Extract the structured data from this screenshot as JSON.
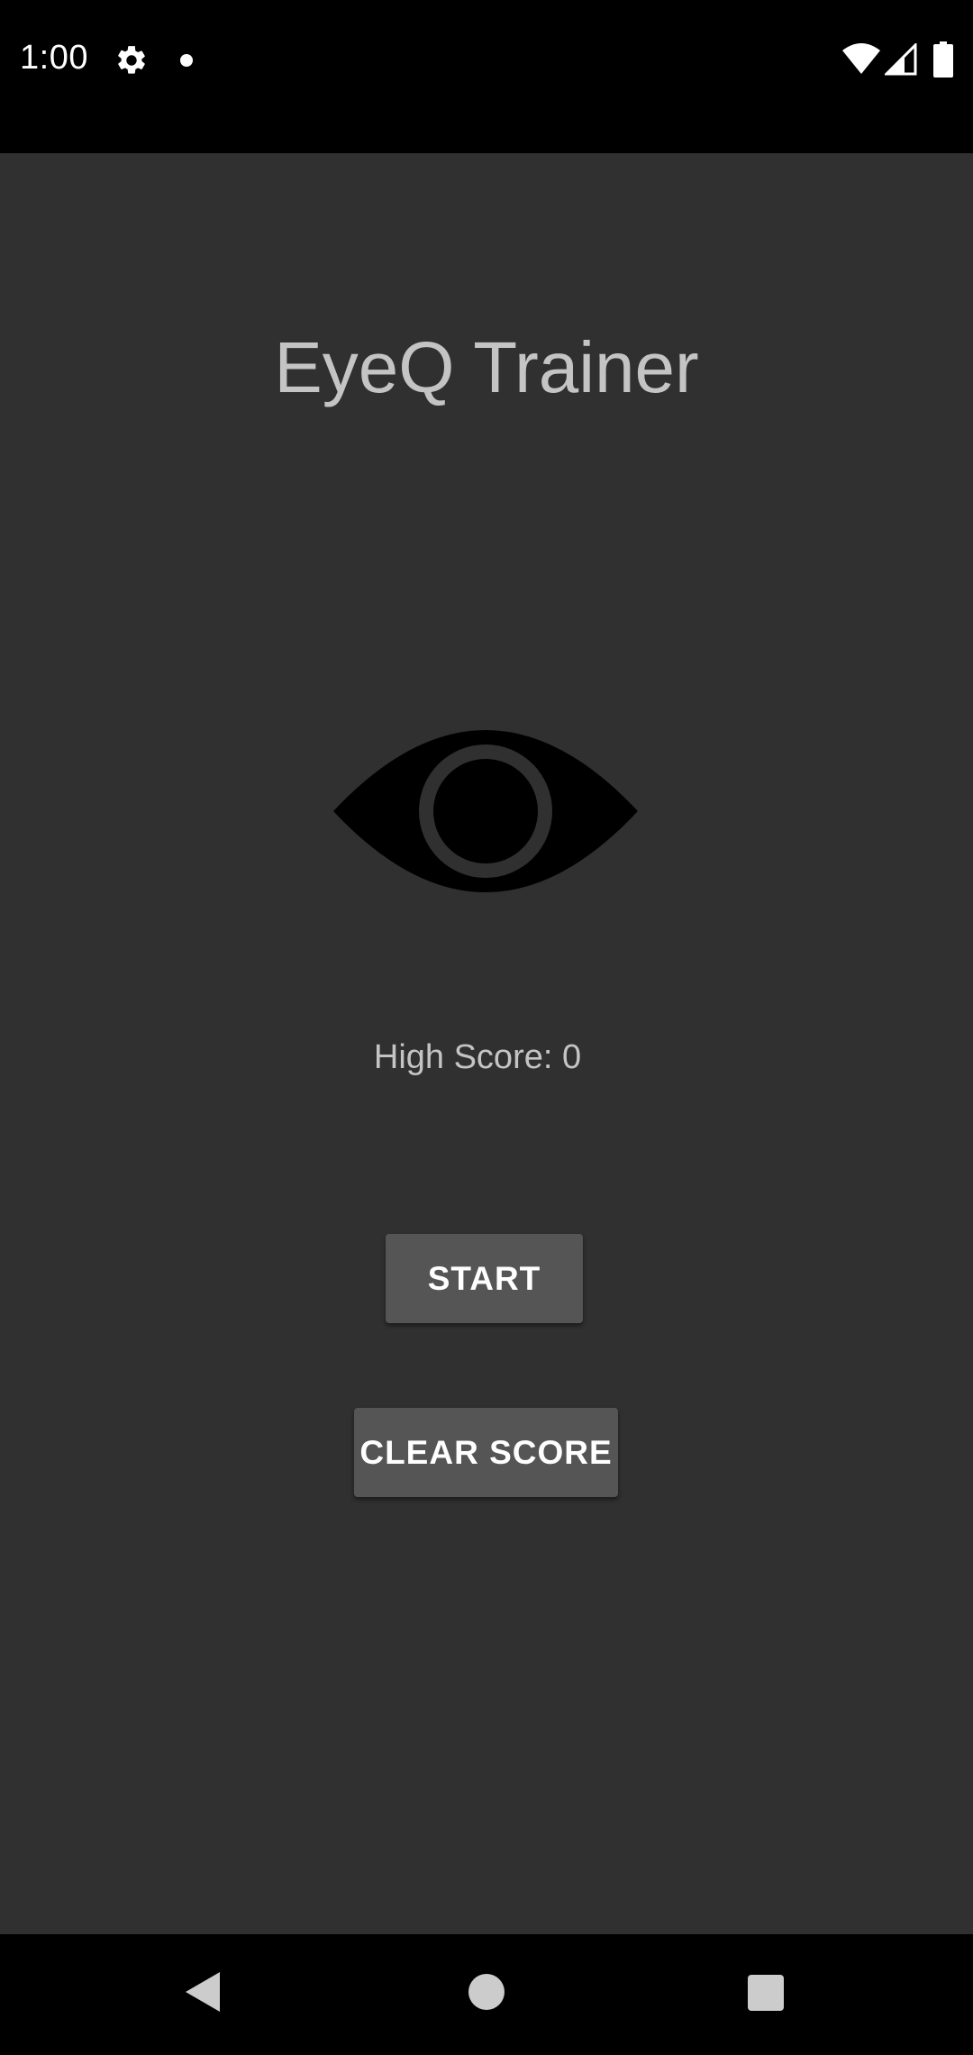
{
  "status_bar": {
    "time": "1:00",
    "icons": [
      "gear-icon",
      "notification-dot-icon",
      "wifi-icon",
      "cell-signal-icon",
      "battery-icon"
    ]
  },
  "app": {
    "title": "EyeQ Trainer",
    "logo_icon": "eye-icon",
    "high_score_text": "High Score: 0",
    "start_label": "START",
    "clear_score_label": "CLEAR SCORE"
  },
  "nav_bar": {
    "icons": [
      "back-icon",
      "home-icon",
      "recents-icon"
    ]
  },
  "colors": {
    "background": "#303030",
    "status_bar": "#000000",
    "button": "#555555",
    "text": "#c4c4c4",
    "button_text": "#ffffff"
  }
}
